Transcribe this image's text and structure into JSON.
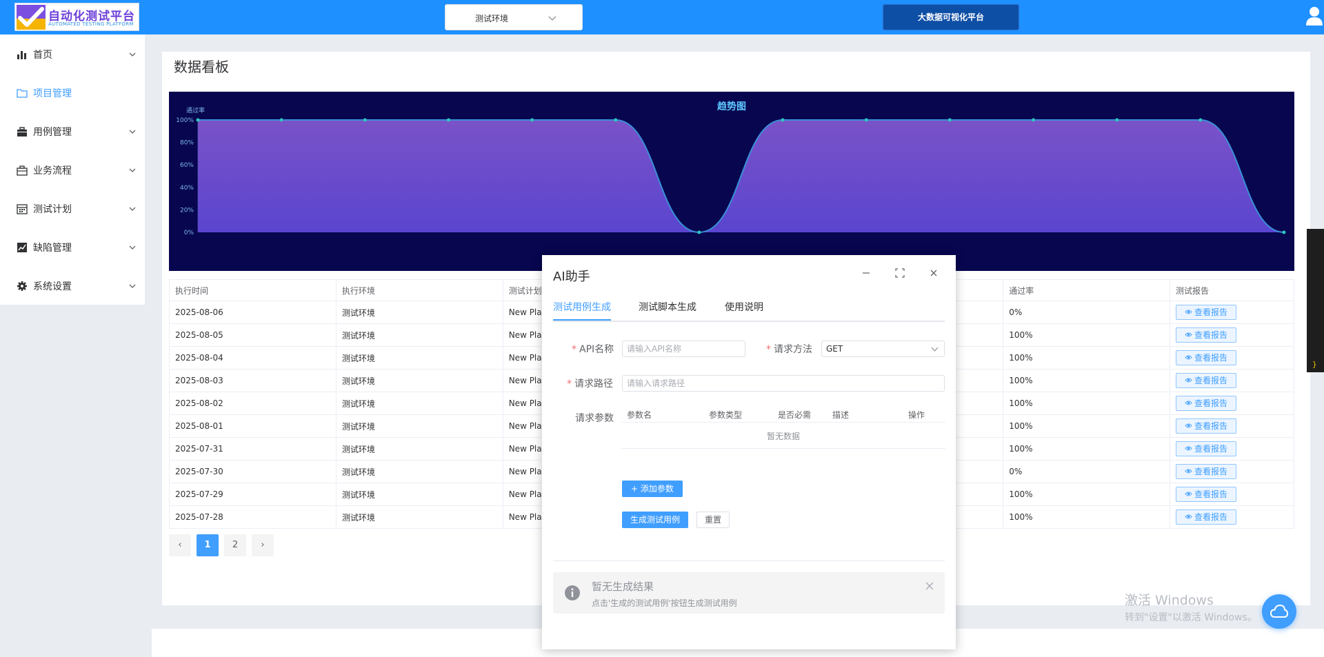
{
  "header": {
    "logo_title": "自动化测试平台",
    "logo_subtitle": "AUTOMATED TESTING PLATFORM",
    "env_select_value": "测试环境",
    "bigdata_button": "大数据可视化平台"
  },
  "sidebar": {
    "items": [
      {
        "label": "首页",
        "icon": "bar-chart-icon",
        "has_arrow": true,
        "active": false
      },
      {
        "label": "项目管理",
        "icon": "folder-icon",
        "has_arrow": false,
        "active": true
      },
      {
        "label": "用例管理",
        "icon": "briefcase-icon",
        "has_arrow": true,
        "active": false
      },
      {
        "label": "业务流程",
        "icon": "suitcase-icon",
        "has_arrow": true,
        "active": false
      },
      {
        "label": "测试计划",
        "icon": "calendar-icon",
        "has_arrow": true,
        "active": false
      },
      {
        "label": "缺陷管理",
        "icon": "trend-icon",
        "has_arrow": true,
        "active": false
      },
      {
        "label": "系统设置",
        "icon": "gear-icon",
        "has_arrow": true,
        "active": false
      }
    ]
  },
  "main": {
    "title": "数据看板"
  },
  "chart_data": {
    "type": "area",
    "title": "趋势图",
    "ylabel": "通过率",
    "y_ticks": [
      "0%",
      "20%",
      "40%",
      "60%",
      "80%",
      "100%"
    ],
    "ylim": [
      0,
      100
    ],
    "values": [
      100,
      100,
      100,
      100,
      100,
      100,
      0,
      100,
      100,
      100,
      100,
      100,
      100,
      0
    ],
    "grid": false,
    "colors": {
      "background": "#07064f",
      "fill_top": "#7a52c8",
      "fill_bottom": "#5a45cf",
      "line": "#3a8fd8",
      "point": "#2ec6c0"
    }
  },
  "table": {
    "headers": [
      "执行时间",
      "执行环境",
      "测试计划",
      "",
      "",
      "通过率",
      "测试报告"
    ],
    "report_label": "查看报告",
    "rows": [
      {
        "time": "2025-08-06",
        "env": "测试环境",
        "plan": "New Plan",
        "rate": "0%"
      },
      {
        "time": "2025-08-05",
        "env": "测试环境",
        "plan": "New Plan",
        "rate": "100%"
      },
      {
        "time": "2025-08-04",
        "env": "测试环境",
        "plan": "New Plan",
        "rate": "100%"
      },
      {
        "time": "2025-08-03",
        "env": "测试环境",
        "plan": "New Plan",
        "rate": "100%"
      },
      {
        "time": "2025-08-02",
        "env": "测试环境",
        "plan": "New Plan",
        "rate": "100%"
      },
      {
        "time": "2025-08-01",
        "env": "测试环境",
        "plan": "New Plan",
        "rate": "100%"
      },
      {
        "time": "2025-07-31",
        "env": "测试环境",
        "plan": "New Plan",
        "rate": "100%"
      },
      {
        "time": "2025-07-30",
        "env": "测试环境",
        "plan": "New Plan",
        "rate": "0%"
      },
      {
        "time": "2025-07-29",
        "env": "测试环境",
        "plan": "New Plan",
        "rate": "100%"
      },
      {
        "time": "2025-07-28",
        "env": "测试环境",
        "plan": "New Plan",
        "rate": "100%"
      }
    ]
  },
  "pagination": {
    "prev": "‹",
    "pages": [
      "1",
      "2"
    ],
    "current": "1",
    "next": "›"
  },
  "dialog": {
    "title": "AI助手",
    "tabs": [
      "测试用例生成",
      "测试脚本生成",
      "使用说明"
    ],
    "active_tab": "测试用例生成",
    "form": {
      "api_name_label": "API名称",
      "api_name_placeholder": "请输入API名称",
      "method_label": "请求方法",
      "method_value": "GET",
      "path_label": "请求路径",
      "path_placeholder": "请输入请求路径",
      "params_label": "请求参数",
      "param_columns": [
        "参数名",
        "参数类型",
        "是否必需",
        "描述",
        "操作"
      ],
      "empty_text": "暂无数据",
      "add_param_button": "添加参数",
      "generate_button": "生成测试用例",
      "reset_button": "重置"
    },
    "alert": {
      "title": "暂无生成结果",
      "description": "点击'生成的测试用例'按钮生成测试用例"
    }
  },
  "watermark": {
    "line1": "激活 Windows",
    "line2": "转到\"设置\"以激活 Windows。"
  },
  "editor_strip_glyph": "}"
}
